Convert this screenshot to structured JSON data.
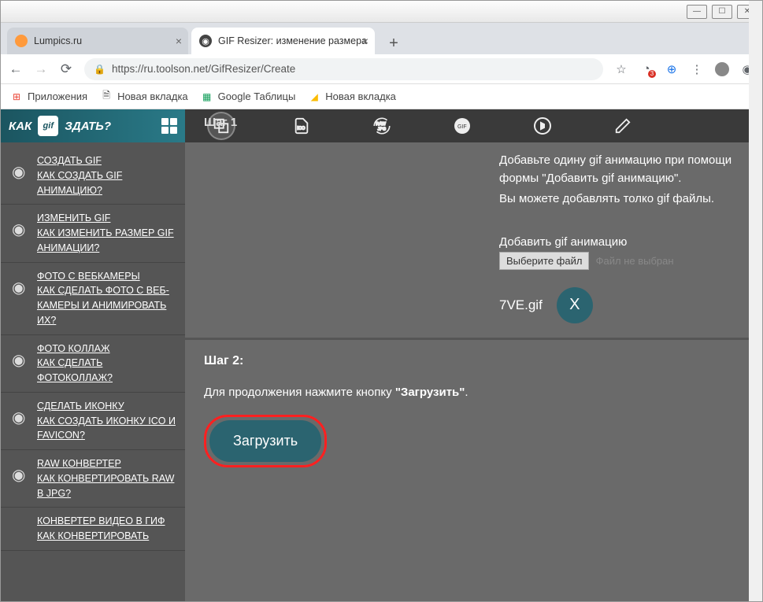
{
  "tabs": [
    {
      "title": "Lumpics.ru"
    },
    {
      "title": "GIF Resizer: изменение размера"
    }
  ],
  "url": "https://ru.toolson.net/GifResizer/Create",
  "bookmarks": [
    "Приложения",
    "Новая вкладка",
    "Google Таблицы",
    "Новая вкладка"
  ],
  "sidebar": {
    "title_left": "КАК",
    "title_right": "ЗДАТЬ?",
    "items": [
      {
        "line1": "СОЗДАТЬ GIF",
        "line2": "КАК СОЗДАТЬ GIF АНИМАЦИЮ?"
      },
      {
        "line1": "ИЗМЕНИТЬ GIF",
        "line2": "КАК ИЗМЕНИТЬ РАЗМЕР GIF АНИМАЦИИ?"
      },
      {
        "line1": "ФОТО С ВЕБКАМЕРЫ",
        "line2": "КАК СДЕЛАТЬ ФОТО С ВЕБ-КАМЕРЫ И АНИМИРОВАТЬ ИХ?"
      },
      {
        "line1": "ФОТО КОЛЛАЖ",
        "line2": "КАК СДЕЛАТЬ ФОТОКОЛЛАЖ?"
      },
      {
        "line1": "СДЕЛАТЬ ИКОНКУ",
        "line2": "КАК СОЗДАТЬ ИКОНКУ ICO И FAVICON?"
      },
      {
        "line1": "RAW КОНВЕРТЕР",
        "line2": "КАК КОНВЕРТИРОВАТЬ RAW В JPG?"
      },
      {
        "line1": "КОНВЕРТЕР ВИДЕО В ГИФ",
        "line2": "КАК КОНВЕРТИРОВАТЬ"
      }
    ]
  },
  "main": {
    "step1_title": "Шаг 1",
    "instr1": "Добавьте одину gif анимацию при помощи формы \"Добавить gif анимацию\".",
    "instr2": "Вы можете добавлять толко gif файлы.",
    "add_label": "Добавить gif анимацию",
    "choose_file": "Выберите файл",
    "file_status": "Файл не выбран",
    "filename": "7VE.gif",
    "remove_x": "X",
    "step2_title": "Шаг 2:",
    "step2_text_a": "Для продолжения нажмите кнопку ",
    "step2_text_b": "\"Загрузить\"",
    "step2_text_c": ".",
    "upload_btn": "Загрузить"
  }
}
